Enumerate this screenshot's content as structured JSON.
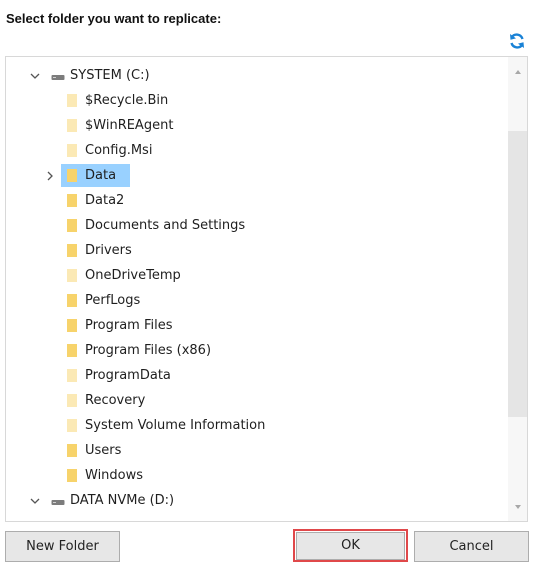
{
  "dialog": {
    "title": "Select folder you want to replicate:"
  },
  "tree": {
    "drives": [
      {
        "label": "SYSTEM  (C:)",
        "expanded": true,
        "folders": [
          {
            "label": "$Recycle.Bin",
            "pale": true
          },
          {
            "label": "$WinREAgent",
            "pale": true
          },
          {
            "label": "Config.Msi",
            "pale": true
          },
          {
            "label": "Data",
            "selected": true,
            "has_children": true
          },
          {
            "label": "Data2"
          },
          {
            "label": "Documents and Settings"
          },
          {
            "label": "Drivers"
          },
          {
            "label": "OneDriveTemp",
            "pale": true
          },
          {
            "label": "PerfLogs"
          },
          {
            "label": "Program Files"
          },
          {
            "label": "Program Files (x86)"
          },
          {
            "label": "ProgramData",
            "pale": true
          },
          {
            "label": "Recovery",
            "pale": true
          },
          {
            "label": "System Volume Information",
            "pale": true
          },
          {
            "label": "Users"
          },
          {
            "label": "Windows"
          }
        ]
      },
      {
        "label": "DATA NVMe (D:)",
        "expanded": true,
        "folders": []
      }
    ]
  },
  "buttons": {
    "new_folder": "New Folder",
    "ok": "OK",
    "cancel": "Cancel"
  },
  "icons": {
    "refresh": "refresh-icon",
    "drive": "drive-icon",
    "folder": "folder-icon",
    "chevron_down": "chevron-down-icon",
    "chevron_right": "chevron-right-icon"
  },
  "colors": {
    "accent": "#1a82d6",
    "selection": "#99d1ff",
    "folder": "#f7d36b",
    "folder_pale": "#fbe9b5",
    "ok_highlight": "#e0484a"
  }
}
